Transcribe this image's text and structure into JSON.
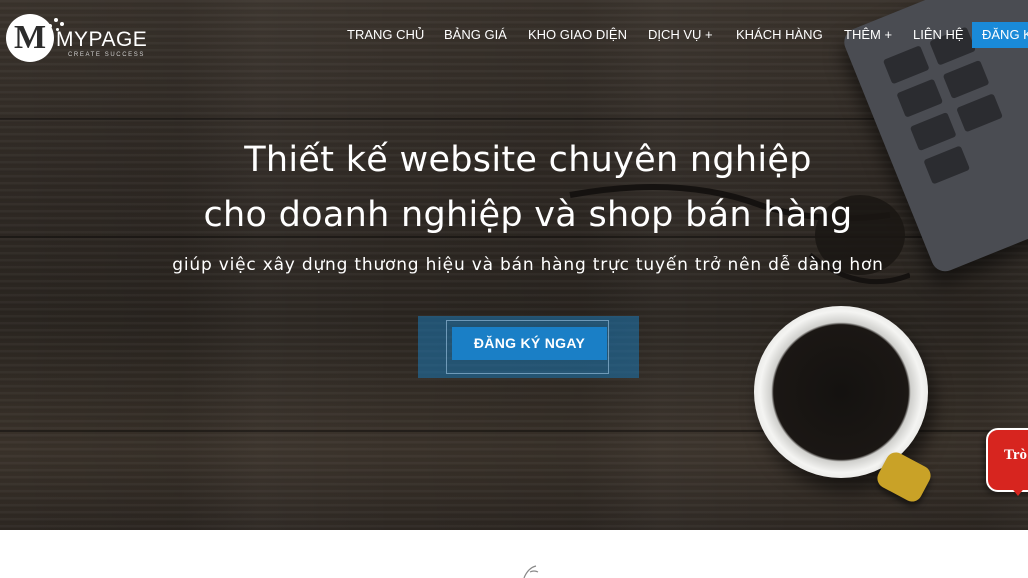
{
  "logo": {
    "letter": "M",
    "name": "MYPAGE",
    "tagline": "CREATE SUCCESS"
  },
  "nav": {
    "items": [
      {
        "label": "TRANG CHỦ"
      },
      {
        "label": "BẢNG GIÁ"
      },
      {
        "label": "KHO GIAO DIỆN"
      },
      {
        "label": "DỊCH VỤ +"
      },
      {
        "label": "KHÁCH HÀNG"
      },
      {
        "label": "THÊM +"
      },
      {
        "label": "LIÊN HỆ"
      }
    ],
    "cta_label": "ĐĂNG KÝ"
  },
  "hero": {
    "title_line1": "Thiết kế website chuyên nghiệp",
    "title_line2": "cho doanh nghiệp và shop bán hàng",
    "subtitle": "giúp việc xây dựng thương hiệu và bán hàng trực tuyến trở nên dễ dàng hơn",
    "cta_label": "ĐĂNG KÝ NGAY"
  },
  "chat_badge": {
    "text": "Trò"
  },
  "colors": {
    "accent": "#1a7fc6",
    "nav_cta": "#1a8ad8",
    "badge": "#d7251f"
  }
}
